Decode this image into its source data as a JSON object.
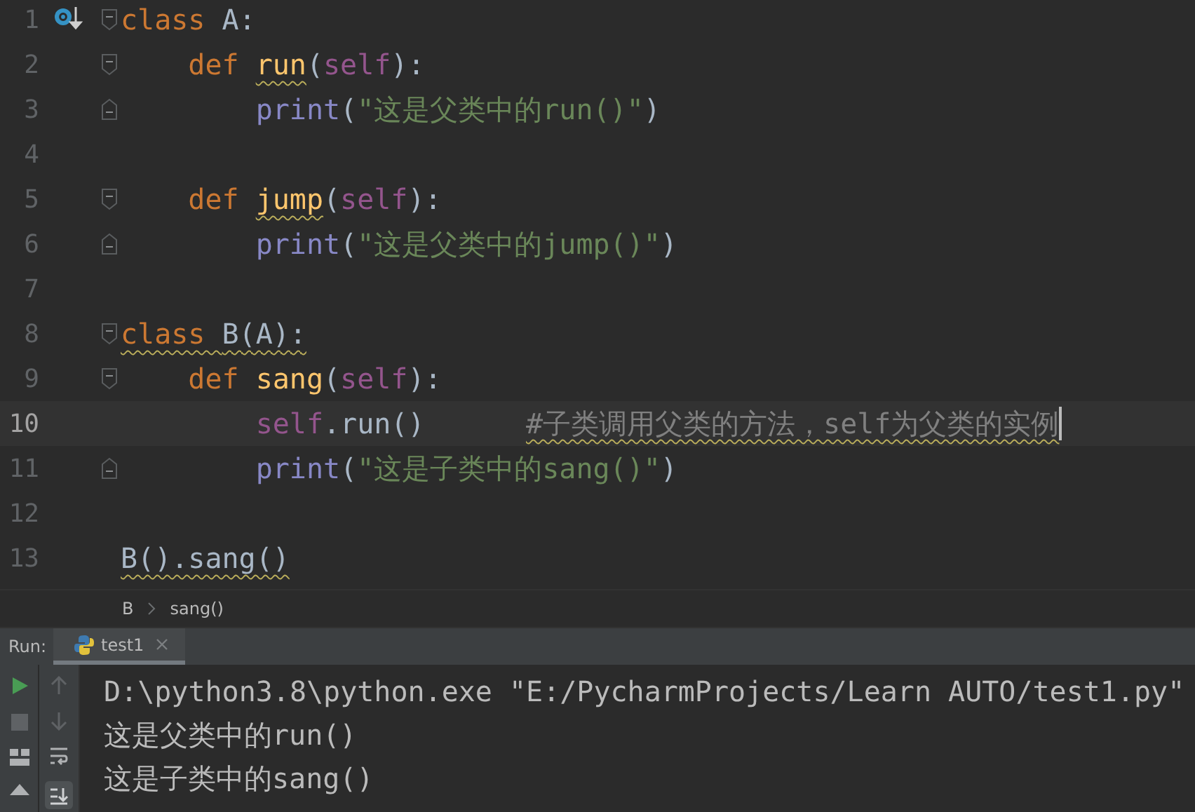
{
  "editor": {
    "lines": [
      {
        "number": "1",
        "current": false,
        "marker": true,
        "fold_open": true,
        "fold_close": false,
        "tokens": [
          {
            "text": "class ",
            "kind": "keyword",
            "squiggle": false
          },
          {
            "text": "A:",
            "kind": "plain",
            "squiggle": false
          }
        ]
      },
      {
        "number": "2",
        "current": false,
        "marker": false,
        "fold_open": true,
        "fold_close": false,
        "tokens": [
          {
            "text": "    def ",
            "kind": "keyword",
            "squiggle": false
          },
          {
            "text": "run",
            "kind": "function",
            "squiggle": true
          },
          {
            "text": "(",
            "kind": "plain",
            "squiggle": false
          },
          {
            "text": "self",
            "kind": "self",
            "squiggle": false
          },
          {
            "text": "):",
            "kind": "plain",
            "squiggle": false
          }
        ]
      },
      {
        "number": "3",
        "current": false,
        "marker": false,
        "fold_open": false,
        "fold_close": true,
        "tokens": [
          {
            "text": "        print",
            "kind": "builtin",
            "squiggle": false
          },
          {
            "text": "(",
            "kind": "plain",
            "squiggle": false
          },
          {
            "text": "\"这是父类中的run()\"",
            "kind": "string",
            "squiggle": false
          },
          {
            "text": ")",
            "kind": "plain",
            "squiggle": false
          }
        ]
      },
      {
        "number": "4",
        "current": false,
        "marker": false,
        "fold_open": false,
        "fold_close": false
      },
      {
        "number": "5",
        "current": false,
        "marker": false,
        "fold_open": true,
        "fold_close": false,
        "tokens": [
          {
            "text": "    def ",
            "kind": "keyword",
            "squiggle": false
          },
          {
            "text": "jump",
            "kind": "function",
            "squiggle": true
          },
          {
            "text": "(",
            "kind": "plain",
            "squiggle": false
          },
          {
            "text": "self",
            "kind": "self",
            "squiggle": false
          },
          {
            "text": "):",
            "kind": "plain",
            "squiggle": false
          }
        ]
      },
      {
        "number": "6",
        "current": false,
        "marker": false,
        "fold_open": false,
        "fold_close": true,
        "tokens": [
          {
            "text": "        print",
            "kind": "builtin",
            "squiggle": false
          },
          {
            "text": "(",
            "kind": "plain",
            "squiggle": false
          },
          {
            "text": "\"这是父类中的jump()\"",
            "kind": "string",
            "squiggle": false
          },
          {
            "text": ")",
            "kind": "plain",
            "squiggle": false
          }
        ]
      },
      {
        "number": "7",
        "current": false,
        "marker": false,
        "fold_open": false,
        "fold_close": false
      },
      {
        "number": "8",
        "current": false,
        "marker": false,
        "fold_open": true,
        "fold_close": false,
        "tokens": [
          {
            "text": "class ",
            "kind": "keyword",
            "squiggle": true
          },
          {
            "text": "B(A):",
            "kind": "plain",
            "squiggle": true
          }
        ]
      },
      {
        "number": "9",
        "current": false,
        "marker": false,
        "fold_open": true,
        "fold_close": false,
        "tokens": [
          {
            "text": "    def ",
            "kind": "keyword",
            "squiggle": false
          },
          {
            "text": "sang",
            "kind": "function",
            "squiggle": false
          },
          {
            "text": "(",
            "kind": "plain",
            "squiggle": false
          },
          {
            "text": "self",
            "kind": "self",
            "squiggle": false
          },
          {
            "text": "):",
            "kind": "plain",
            "squiggle": false
          }
        ]
      },
      {
        "number": "10",
        "current": true,
        "marker": false,
        "fold_open": false,
        "fold_close": false,
        "tokens": [
          {
            "text": "        self",
            "kind": "self",
            "squiggle": false
          },
          {
            "text": ".run()      ",
            "kind": "plain",
            "squiggle": false
          },
          {
            "text": "#子类调用父类的方法，self为父类的实例",
            "kind": "comment",
            "squiggle": true
          }
        ]
      },
      {
        "number": "11",
        "current": false,
        "marker": false,
        "fold_open": false,
        "fold_close": true,
        "tokens": [
          {
            "text": "        print",
            "kind": "builtin",
            "squiggle": false
          },
          {
            "text": "(",
            "kind": "plain",
            "squiggle": false
          },
          {
            "text": "\"这是子类中的sang()\"",
            "kind": "string",
            "squiggle": false
          },
          {
            "text": ")",
            "kind": "plain",
            "squiggle": false
          }
        ]
      },
      {
        "number": "12",
        "current": false,
        "marker": false,
        "fold_open": false,
        "fold_close": false
      },
      {
        "number": "13",
        "current": false,
        "marker": false,
        "fold_open": false,
        "fold_close": false,
        "tokens": [
          {
            "text": "B().sang()",
            "kind": "plain",
            "squiggle": true
          }
        ]
      }
    ]
  },
  "breadcrumb": [
    "B",
    "sang()"
  ],
  "run_panel": {
    "label": "Run:",
    "tabs": [
      {
        "label": "test1",
        "selected": true
      }
    ],
    "console": [
      "D:\\python3.8\\python.exe \"E:/PycharmProjects/Learn AUTO/test1.py\"",
      "这是父类中的run()",
      "这是子类中的sang()"
    ]
  }
}
